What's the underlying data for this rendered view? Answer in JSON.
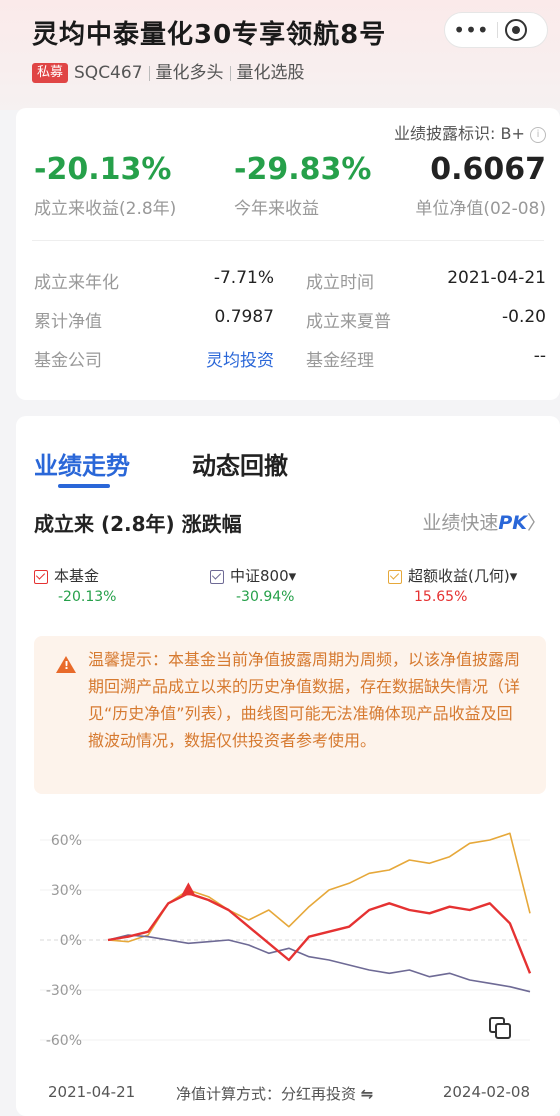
{
  "header": {
    "title": "灵均中泰量化30专享领航8号",
    "tag_private": "私募",
    "code": "SQC467",
    "tag_strategy": "量化多头",
    "tag_sub": "量化选股"
  },
  "capsule": {
    "more": "•••"
  },
  "summary": {
    "disclosure_label": "业绩披露标识: B+",
    "return_since": "-20.13%",
    "return_since_label": "成立来收益(2.8年)",
    "ytd": "-29.83%",
    "ytd_label": "今年来收益",
    "nav": "0.6067",
    "nav_label": "单位净值(02-08)"
  },
  "stats": {
    "annualized_label": "成立来年化",
    "annualized": "-7.71%",
    "inception_label": "成立时间",
    "inception": "2021-04-21",
    "cum_nav_label": "累计净值",
    "cum_nav": "0.7987",
    "sharpe_label": "成立来夏普",
    "sharpe": "-0.20",
    "company_label": "基金公司",
    "company": "灵均投资",
    "manager_label": "基金经理",
    "manager": "--"
  },
  "tabs": {
    "perf": "业绩走势",
    "drawdown": "动态回撤"
  },
  "period_title": "成立来 (2.8年) 涨跌幅",
  "pk_label": "业绩快速",
  "pk_strong": "PK",
  "legend": {
    "fund": "本基金",
    "fund_value": "-20.13%",
    "index": "中证800▾",
    "index_value": "-30.94%",
    "excess": "超额收益(几何)▾",
    "excess_value": "15.65%"
  },
  "notice": "温馨提示：本基金当前净值披露周期为周频，以该净值披露周期回溯产品成立以来的历史净值数据，存在数据缺失情况（详见“历史净值”列表），曲线图可能无法准确体现产品收益及回撤波动情况，数据仅供投资者参考使用。",
  "footer": {
    "start": "2021-04-21",
    "method": "净值计算方式：分红再投资",
    "end": "2024-02-08"
  },
  "colors": {
    "fund": "#e53232",
    "index": "#6e6a95",
    "excess": "#e6a83a",
    "accent": "#2a67d8"
  },
  "chart_data": {
    "type": "line",
    "x": [
      "2021-04-21",
      "2024-02-08"
    ],
    "ylabel": "",
    "yticks": [
      "60%",
      "30%",
      "0%",
      "-30%",
      "-60%"
    ],
    "ylim": [
      -60,
      60
    ],
    "series": [
      {
        "name": "本基金",
        "values": [
          0,
          2,
          5,
          22,
          28,
          24,
          18,
          8,
          -2,
          -12,
          2,
          5,
          8,
          18,
          22,
          18,
          16,
          20,
          18,
          22,
          10,
          -20
        ]
      },
      {
        "name": "中证800",
        "values": [
          0,
          3,
          2,
          0,
          -2,
          -1,
          0,
          -3,
          -8,
          -5,
          -10,
          -12,
          -15,
          -18,
          -20,
          -18,
          -22,
          -20,
          -24,
          -26,
          -28,
          -31
        ]
      },
      {
        "name": "超额收益(几何)",
        "values": [
          0,
          -1,
          3,
          22,
          30,
          26,
          18,
          12,
          18,
          8,
          20,
          30,
          34,
          40,
          42,
          48,
          46,
          50,
          58,
          60,
          64,
          16
        ]
      }
    ]
  }
}
